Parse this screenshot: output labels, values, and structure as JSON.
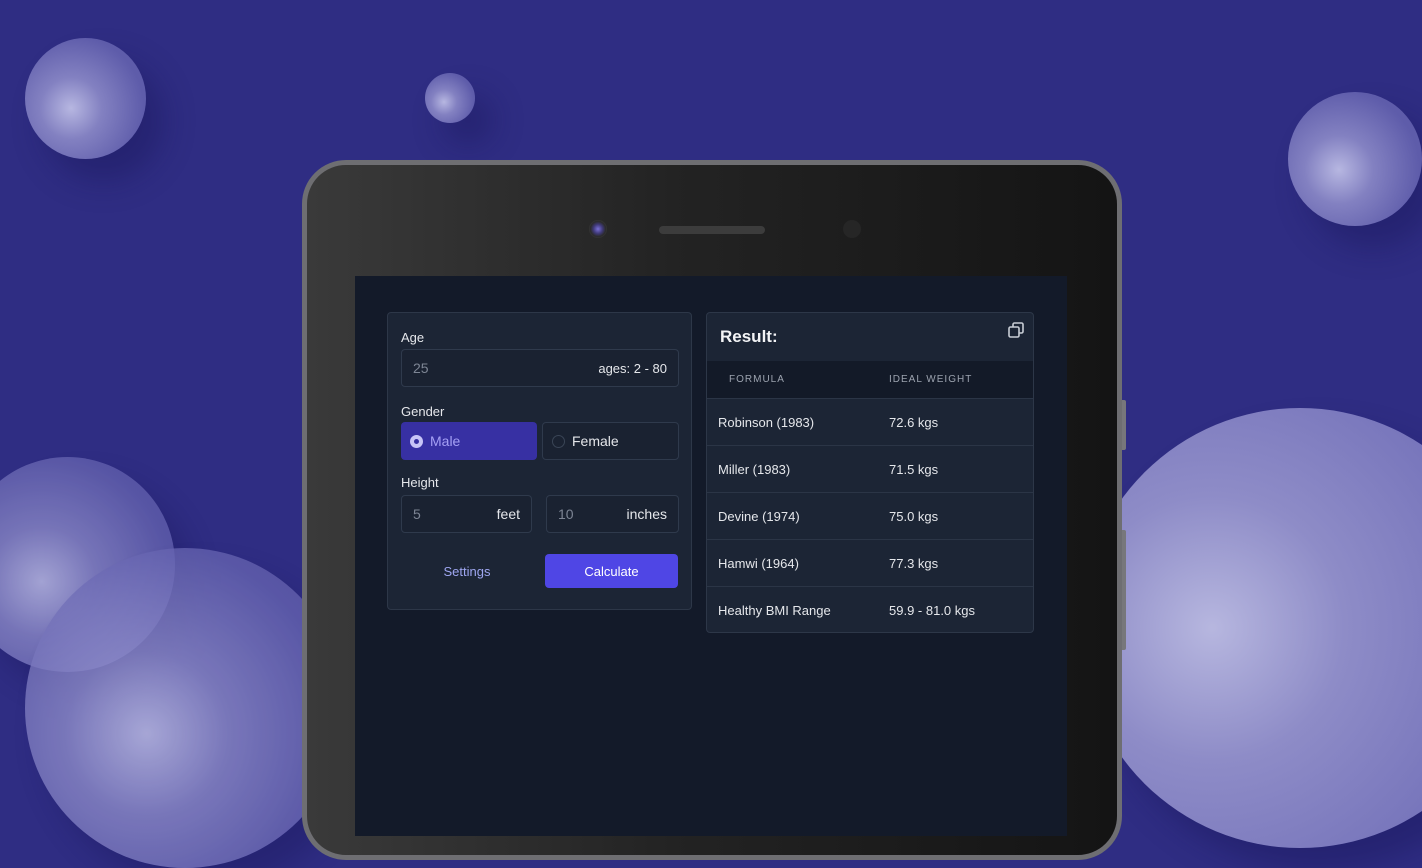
{
  "form": {
    "age_label": "Age",
    "age_value": "25",
    "age_hint": "ages: 2 - 80",
    "gender_label": "Gender",
    "gender_options": [
      "Male",
      "Female"
    ],
    "gender_selected": "Male",
    "height_label": "Height",
    "height_feet_value": "5",
    "height_feet_unit": "feet",
    "height_inches_value": "10",
    "height_inches_unit": "inches",
    "settings_label": "Settings",
    "calculate_label": "Calculate"
  },
  "result": {
    "title": "Result:",
    "copy_icon": "copy-icon",
    "columns": [
      "FORMULA",
      "IDEAL WEIGHT"
    ],
    "rows": [
      {
        "formula": "Robinson (1983)",
        "weight": "72.6 kgs"
      },
      {
        "formula": "Miller (1983)",
        "weight": "71.5 kgs"
      },
      {
        "formula": "Devine (1974)",
        "weight": "75.0 kgs"
      },
      {
        "formula": "Hamwi (1964)",
        "weight": "77.3 kgs"
      },
      {
        "formula": "Healthy BMI Range",
        "weight": "59.9 - 81.0 kgs"
      }
    ]
  },
  "colors": {
    "background": "#2f2d83",
    "accent": "#4f46e5",
    "selected_option": "#3730a3",
    "card": "#1c2535",
    "screen": "#131a29"
  }
}
